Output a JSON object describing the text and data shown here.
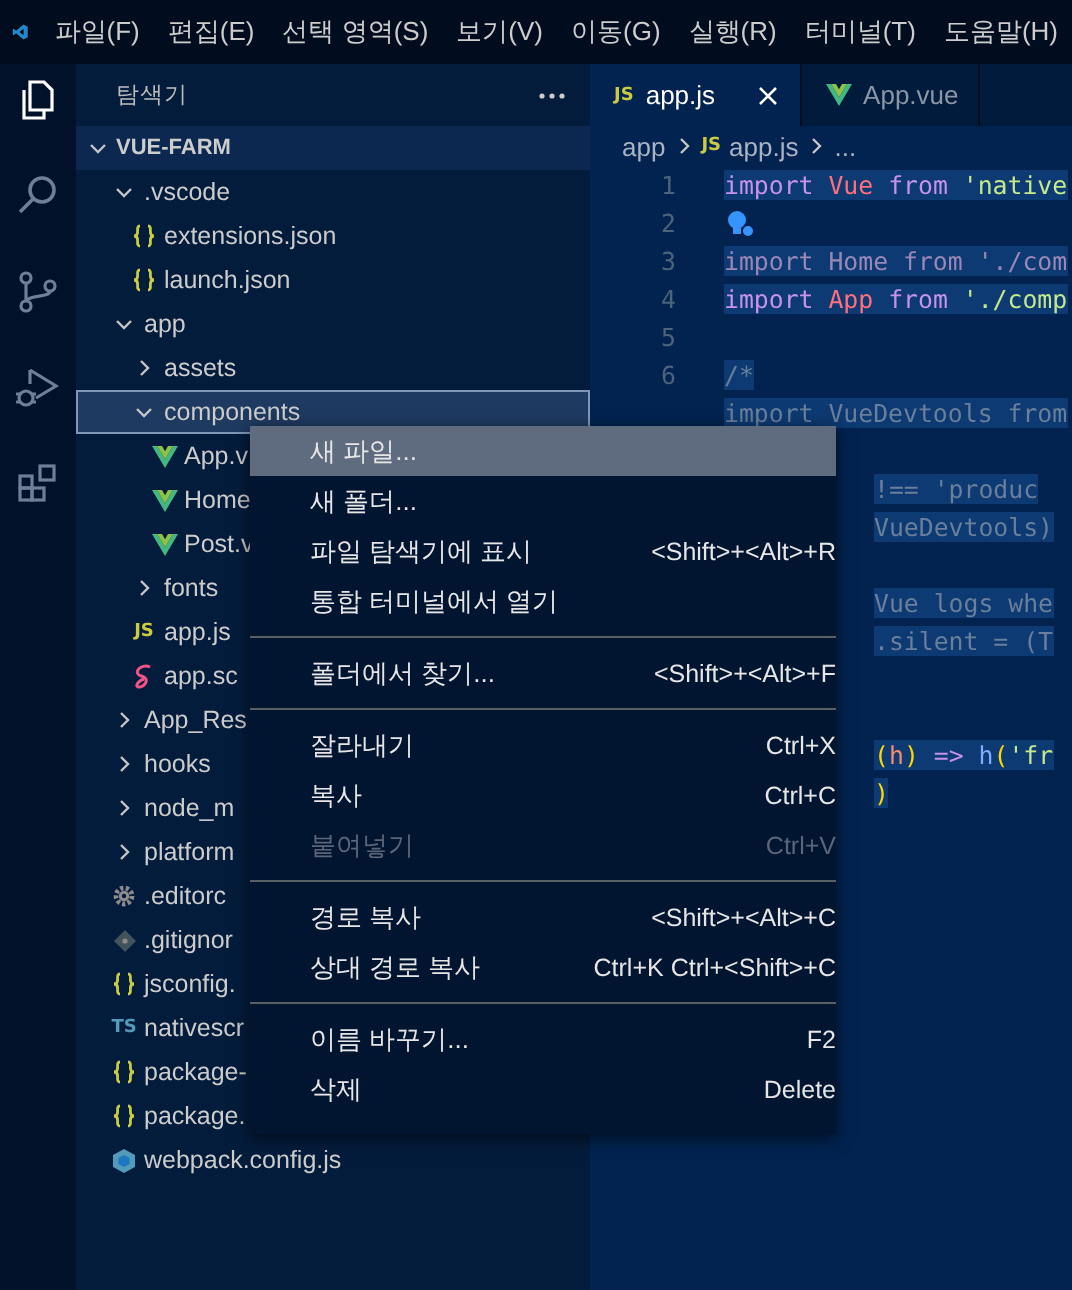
{
  "menu_bar": {
    "items": [
      "파일(F)",
      "편집(E)",
      "선택 영역(S)",
      "보기(V)",
      "이동(G)",
      "실행(R)",
      "터미널(T)",
      "도움말(H)"
    ]
  },
  "activity_bar": [
    {
      "kind": "explorer",
      "selected": true
    },
    {
      "kind": "search",
      "selected": false
    },
    {
      "kind": "source_control",
      "selected": false
    },
    {
      "kind": "run_debug",
      "selected": false
    },
    {
      "kind": "extensions",
      "selected": false
    }
  ],
  "explorer": {
    "title": "탐색기",
    "root": {
      "name": "VUE-FARM",
      "expanded": true,
      "children": [
        {
          "name": ".vscode",
          "kind": "folder",
          "expanded": true,
          "selected": false,
          "children": [
            {
              "name": "extensions.json",
              "kind": "json",
              "selected": false
            },
            {
              "name": "launch.json",
              "kind": "json",
              "selected": false
            }
          ]
        },
        {
          "name": "app",
          "kind": "folder",
          "expanded": true,
          "selected": false,
          "children": [
            {
              "name": "assets",
              "kind": "folder",
              "expanded": false,
              "selected": false
            },
            {
              "name": "components",
              "kind": "folder",
              "expanded": true,
              "selected": true,
              "children": [
                {
                  "name": "App.v",
                  "kind": "vue",
                  "selected": false
                },
                {
                  "name": "Home",
                  "kind": "vue",
                  "selected": false
                },
                {
                  "name": "Post.v",
                  "kind": "vue",
                  "selected": false
                }
              ]
            },
            {
              "name": "fonts",
              "kind": "folder",
              "expanded": false,
              "selected": false
            },
            {
              "name": "app.js",
              "kind": "js",
              "badge": "JS",
              "selected": false
            },
            {
              "name": "app.sc",
              "kind": "sass",
              "selected": false
            }
          ]
        },
        {
          "name": "App_Res",
          "kind": "folder",
          "expanded": false,
          "selected": false
        },
        {
          "name": "hooks",
          "kind": "folder",
          "expanded": false,
          "selected": false
        },
        {
          "name": "node_m",
          "kind": "folder",
          "expanded": false,
          "selected": false
        },
        {
          "name": "platform",
          "kind": "folder",
          "expanded": false,
          "selected": false
        },
        {
          "name": ".editorc",
          "kind": "gear",
          "selected": false
        },
        {
          "name": ".gitignor",
          "kind": "git",
          "selected": false
        },
        {
          "name": "jsconfig.",
          "kind": "json",
          "selected": false
        },
        {
          "name": "nativescr",
          "kind": "ts",
          "badge": "TS",
          "selected": false
        },
        {
          "name": "package-",
          "kind": "json",
          "selected": false
        },
        {
          "name": "package.",
          "kind": "json",
          "selected": false
        },
        {
          "name": "webpack.config.js",
          "kind": "webpack",
          "selected": false
        }
      ]
    }
  },
  "tabs": [
    {
      "label": "app.js",
      "kind": "js",
      "badge": "JS",
      "selected": true
    },
    {
      "label": "App.vue",
      "kind": "vue",
      "selected": false
    }
  ],
  "breadcrumb": [
    {
      "label": "app",
      "kind": "folder"
    },
    {
      "label": "app.js",
      "kind": "js",
      "badge": "JS"
    },
    {
      "label": "...",
      "kind": "ellipsis"
    }
  ],
  "code_lines": [
    {
      "kind": "code",
      "number": "1",
      "tokens": [
        {
          "kind": "keyword",
          "text": "import "
        },
        {
          "kind": "variable",
          "text": "Vue "
        },
        {
          "kind": "keyword",
          "text": "from "
        },
        {
          "kind": "string",
          "text": "'native"
        }
      ]
    },
    {
      "kind": "lightbulb",
      "number": "2"
    },
    {
      "kind": "code",
      "number": "3",
      "tokens": [
        {
          "kind": "faded",
          "text": "import Home from './com"
        }
      ]
    },
    {
      "kind": "code",
      "number": "4",
      "tokens": [
        {
          "kind": "keyword",
          "text": "import "
        },
        {
          "kind": "variable",
          "text": "App "
        },
        {
          "kind": "keyword",
          "text": "from "
        },
        {
          "kind": "string",
          "text": "'./comp"
        }
      ]
    },
    {
      "kind": "blank",
      "number": "5"
    },
    {
      "kind": "code",
      "number": "6",
      "tokens": [
        {
          "kind": "comment",
          "text": "/*"
        }
      ]
    },
    {
      "kind": "code",
      "tokens": [
        {
          "kind": "comment",
          "text": "import VueDevtools from"
        }
      ]
    },
    {
      "kind": "hidden"
    },
    {
      "kind": "partial",
      "tokens": [
        {
          "kind": "comment",
          "text": "!== 'produc"
        }
      ]
    },
    {
      "kind": "partial",
      "tokens": [
        {
          "kind": "comment",
          "text": "VueDevtools)"
        }
      ]
    },
    {
      "kind": "hidden"
    },
    {
      "kind": "partial",
      "tokens": [
        {
          "kind": "comment",
          "text": "Vue logs whe"
        }
      ]
    },
    {
      "kind": "partial",
      "tokens": [
        {
          "kind": "comment",
          "text": ".silent = (T"
        }
      ]
    },
    {
      "kind": "hidden"
    },
    {
      "kind": "hidden"
    },
    {
      "kind": "partial",
      "tokens": [
        {
          "kind": "bracket",
          "text": "("
        },
        {
          "kind": "param",
          "text": "h"
        },
        {
          "kind": "bracket",
          "text": ") "
        },
        {
          "kind": "keyword",
          "text": "=> "
        },
        {
          "kind": "function",
          "text": "h"
        },
        {
          "kind": "bracket",
          "text": "("
        },
        {
          "kind": "string",
          "text": "'fr"
        }
      ]
    },
    {
      "kind": "partial",
      "tokens": [
        {
          "kind": "bracket",
          "text": ")"
        }
      ]
    }
  ],
  "context_menu": [
    {
      "kind": "item",
      "label": "새 파일...",
      "selected": true,
      "disabled": false
    },
    {
      "kind": "item",
      "label": "새 폴더...",
      "selected": false,
      "disabled": false
    },
    {
      "kind": "item",
      "label": "파일 탐색기에 표시",
      "shortcut": "<Shift>+<Alt>+R",
      "selected": false,
      "disabled": false
    },
    {
      "kind": "item",
      "label": "통합 터미널에서 열기",
      "selected": false,
      "disabled": false
    },
    {
      "kind": "separator"
    },
    {
      "kind": "item",
      "label": "폴더에서 찾기...",
      "shortcut": "<Shift>+<Alt>+F",
      "selected": false,
      "disabled": false
    },
    {
      "kind": "separator"
    },
    {
      "kind": "item",
      "label": "잘라내기",
      "shortcut": "Ctrl+X",
      "selected": false,
      "disabled": false
    },
    {
      "kind": "item",
      "label": "복사",
      "shortcut": "Ctrl+C",
      "selected": false,
      "disabled": false
    },
    {
      "kind": "item",
      "label": "붙여넣기",
      "shortcut": "Ctrl+V",
      "selected": false,
      "disabled": true
    },
    {
      "kind": "separator"
    },
    {
      "kind": "item",
      "label": "경로 복사",
      "shortcut": "<Shift>+<Alt>+C",
      "selected": false,
      "disabled": false
    },
    {
      "kind": "item",
      "label": "상대 경로 복사",
      "shortcut": "Ctrl+K Ctrl+<Shift>+C",
      "selected": false,
      "disabled": false
    },
    {
      "kind": "separator"
    },
    {
      "kind": "item",
      "label": "이름 바꾸기...",
      "shortcut": "F2",
      "selected": false,
      "disabled": false
    },
    {
      "kind": "item",
      "label": "삭제",
      "shortcut": "Delete",
      "selected": false,
      "disabled": false
    }
  ]
}
